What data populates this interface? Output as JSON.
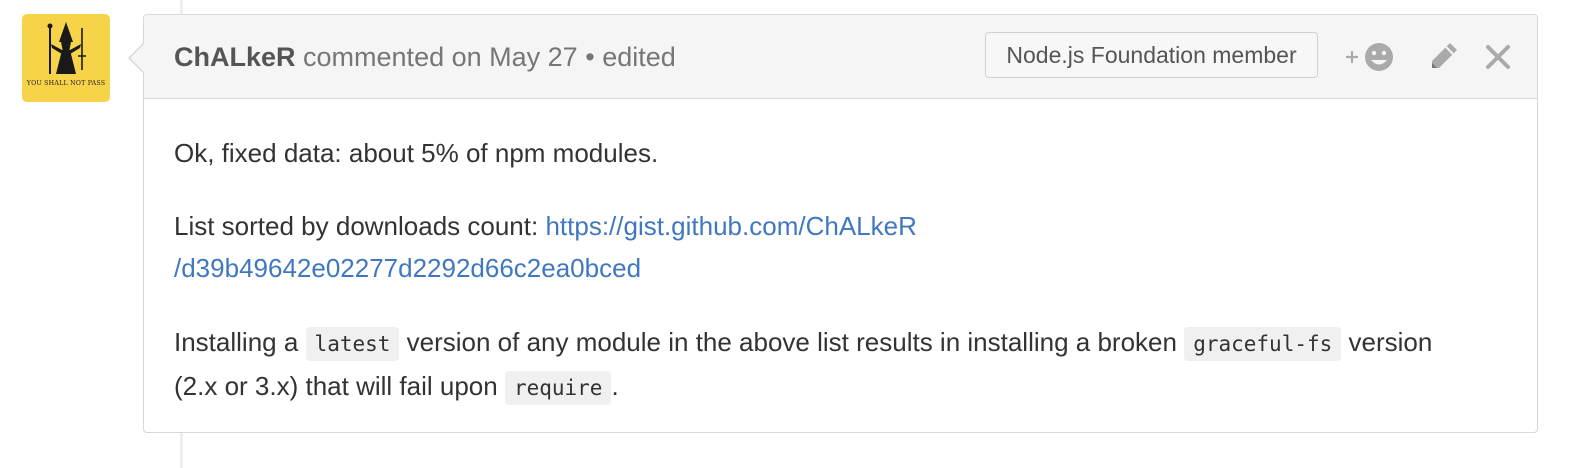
{
  "avatar": {
    "caption": "YOU SHALL NOT PASS"
  },
  "comment": {
    "author": "ChALkeR",
    "action_text": "commented on",
    "date": "May 27",
    "separator": "•",
    "edited": "edited",
    "badge": "Node.js Foundation member",
    "actions": {
      "reaction_icon": "add-reaction-smiley-icon",
      "edit_icon": "pencil-icon",
      "delete_icon": "close-icon"
    },
    "body": {
      "p1": "Ok, fixed data: about 5% of npm modules.",
      "p2_text": "List sorted by downloads count:",
      "p2_link_line1": "https://gist.github.com/ChALkeR",
      "p2_link_line2": "/d39b49642e02277d2292d66c2ea0bced",
      "p3_part1": "Installing a",
      "p3_code1": "latest",
      "p3_part2": "version of any module in the above list results in installing a broken",
      "p3_code2": "graceful-fs",
      "p3_part3": "version (2.x or 3.x) that will fail upon",
      "p3_code3": "require",
      "p3_part4": "."
    }
  },
  "colors": {
    "link": "#4078c0",
    "header_bg": "#f5f5f5",
    "border": "#d8d8d8",
    "avatar_bg": "#f7d34a",
    "icon": "#aaaaaa"
  }
}
